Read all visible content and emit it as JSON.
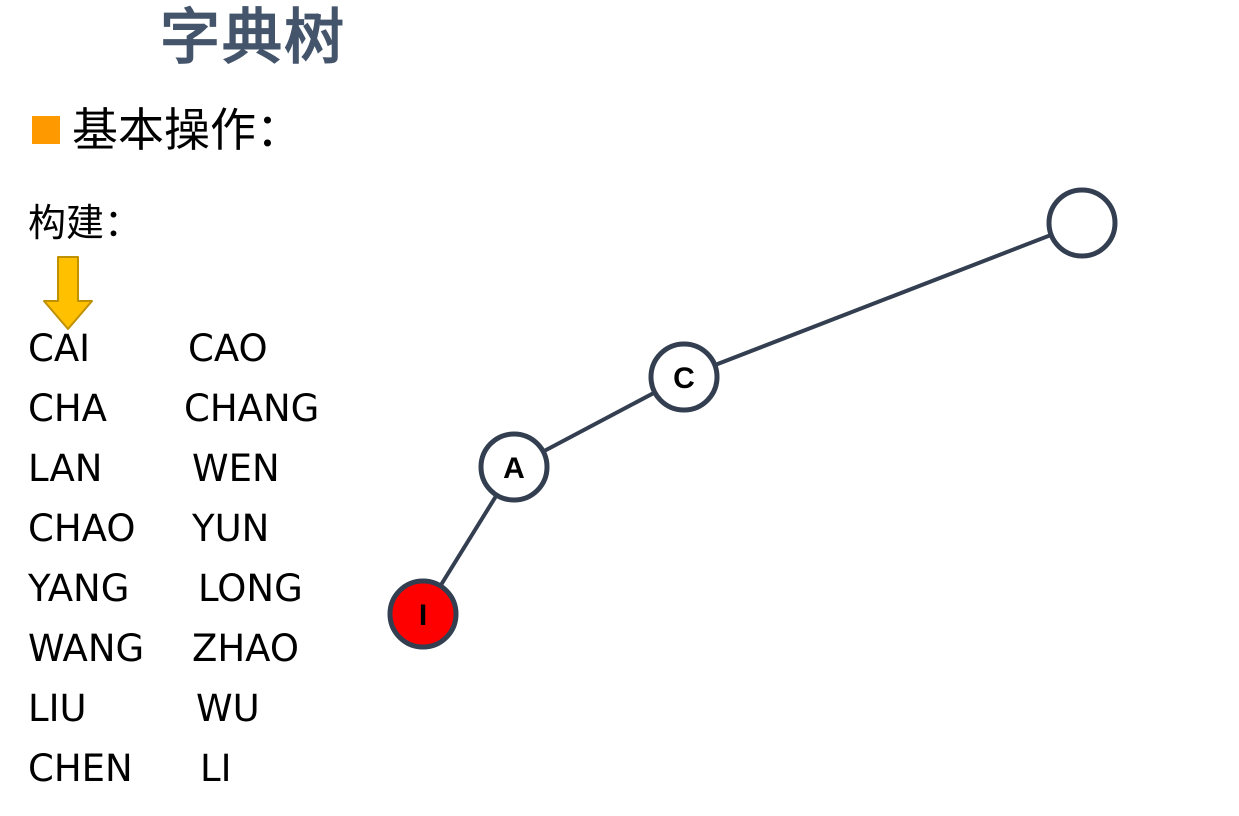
{
  "title": "字典树",
  "subheading": "基本操作：",
  "build_label": "构建：",
  "words": {
    "left": [
      "CAI",
      "CHA",
      "LAN",
      "CHAO",
      "YANG",
      "WANG",
      "LIU",
      "CHEN"
    ],
    "right": [
      "CAO",
      "CHANG",
      "WEN",
      "YUN",
      "LONG",
      "ZHAO",
      "WU",
      "LI"
    ]
  },
  "tree": {
    "nodes": [
      {
        "id": "root",
        "label": "",
        "fill": "#ffffff"
      },
      {
        "id": "c",
        "label": "C",
        "fill": "#ffffff"
      },
      {
        "id": "a",
        "label": "A",
        "fill": "#ffffff"
      },
      {
        "id": "i",
        "label": "I",
        "fill": "#ff0000"
      }
    ],
    "edges": [
      {
        "from": "root",
        "to": "c"
      },
      {
        "from": "c",
        "to": "a"
      },
      {
        "from": "a",
        "to": "i"
      }
    ],
    "stroke_color": "#333f50"
  },
  "colors": {
    "title": "#44546a",
    "bullet": "#ff9900",
    "arrow_fill": "#ffc000",
    "arrow_stroke": "#bf9000"
  },
  "icons": {
    "bullet": "square-bullet-icon",
    "arrow": "down-arrow-icon"
  }
}
